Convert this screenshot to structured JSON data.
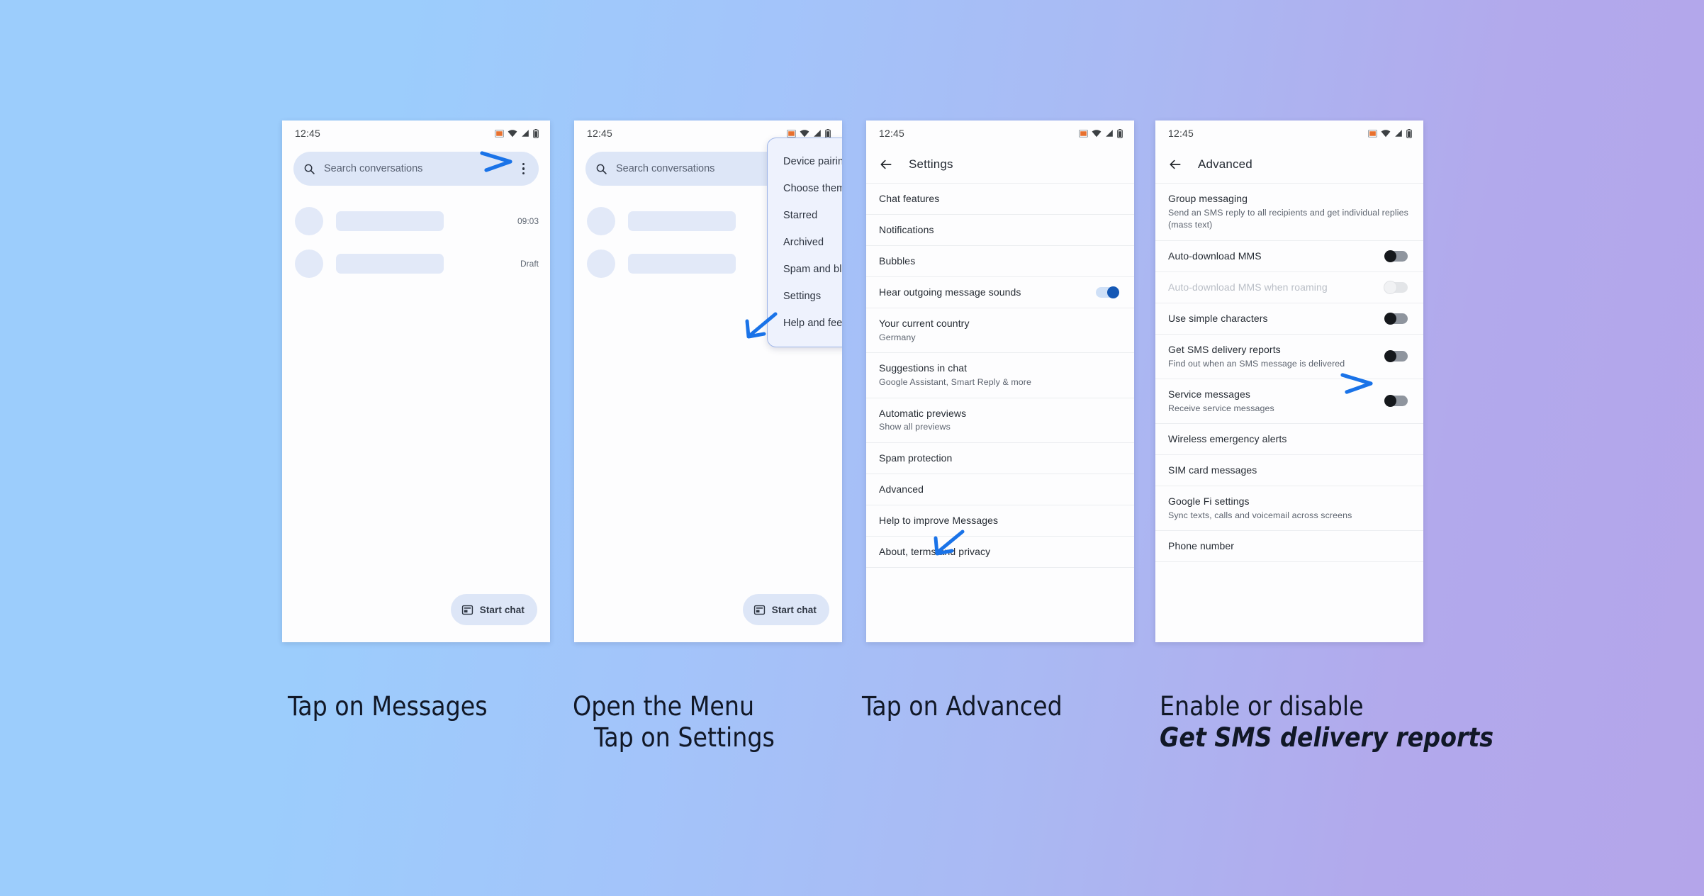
{
  "background": {
    "from": "#9ccdfc",
    "to": "#b4a5ea"
  },
  "accent_arrow_color": "#1a73e8",
  "status_bar": {
    "time": "12:45",
    "icons": [
      "screen-cast-icon",
      "wifi-icon",
      "signal-icon",
      "battery-icon"
    ]
  },
  "screen1": {
    "search": {
      "placeholder": "Search conversations",
      "icon": "search-icon"
    },
    "overflow_icon": "more-vert-icon",
    "conversations": [
      {
        "time": "09:03"
      },
      {
        "time": "Draft"
      }
    ],
    "fab": {
      "label": "Start chat",
      "icon": "new-message-icon"
    }
  },
  "screen2": {
    "search": {
      "placeholder": "Search conversations",
      "icon": "search-icon"
    },
    "fab": {
      "label": "Start chat",
      "icon": "new-message-icon"
    },
    "menu_items": [
      "Device pairing",
      "Choose theme",
      "Starred",
      "Archived",
      "Spam and blocked",
      "Settings",
      "Help and feedback"
    ]
  },
  "screen3": {
    "back_icon": "arrow-back-icon",
    "title": "Settings",
    "rows": [
      {
        "title": "Chat features"
      },
      {
        "title": "Notifications"
      },
      {
        "title": "Bubbles"
      },
      {
        "title": "Hear outgoing message sounds",
        "toggle": "on"
      },
      {
        "title": "Your current country",
        "sub": "Germany"
      },
      {
        "title": "Suggestions in chat",
        "sub": "Google Assistant, Smart Reply & more"
      },
      {
        "title": "Automatic previews",
        "sub": "Show all previews"
      },
      {
        "title": "Spam protection"
      },
      {
        "title": "Advanced"
      },
      {
        "title": "Help to improve Messages"
      },
      {
        "title": "About, terms and privacy"
      }
    ]
  },
  "screen4": {
    "back_icon": "arrow-back-icon",
    "title": "Advanced",
    "rows": [
      {
        "title": "Group messaging",
        "sub": "Send an SMS reply to all recipients and get individual replies (mass text)"
      },
      {
        "title": "Auto-download MMS",
        "toggle": "off"
      },
      {
        "title": "Auto-download MMS when roaming",
        "toggle": "disabled",
        "dim": true
      },
      {
        "title": "Use simple characters",
        "toggle": "off"
      },
      {
        "title": "Get SMS delivery reports",
        "sub": "Find out when an SMS message is delivered",
        "toggle": "off"
      },
      {
        "title": "Service messages",
        "sub": "Receive service messages",
        "toggle": "off"
      },
      {
        "title": "Wireless emergency alerts"
      },
      {
        "title": "SIM card messages"
      },
      {
        "title": "Google Fi settings",
        "sub": "Sync texts, calls and voicemail across screens"
      },
      {
        "title": "Phone number"
      }
    ]
  },
  "captions": {
    "c1_line1": "Tap on Messages",
    "c2_line1": "Open the Menu",
    "c2_line2": "Tap on Settings",
    "c3_line1": "Tap on Advanced",
    "c4_line1": "Enable or disable",
    "c4_line2": "Get SMS delivery reports"
  }
}
